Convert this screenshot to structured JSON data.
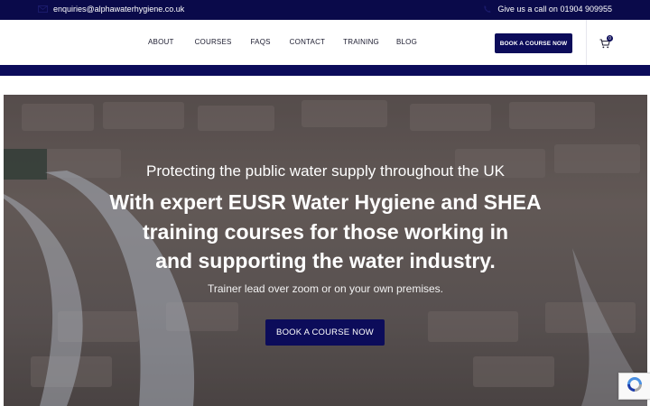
{
  "topbar": {
    "email": "enquiries@alphawaterhygiene.co.uk",
    "phone": "Give us a call on 01904 909955",
    "email_icon": "envelope-icon",
    "phone_icon": "phone-icon"
  },
  "nav": {
    "items": [
      {
        "label": "ABOUT"
      },
      {
        "label": "COURSES"
      },
      {
        "label": "FAQS"
      },
      {
        "label": "CONTACT"
      },
      {
        "label": "TRAINING"
      },
      {
        "label": "BLOG"
      }
    ],
    "cta_label": "BOOK A COURSE NOW",
    "cart_count": "0",
    "cart_icon": "cart-icon"
  },
  "hero": {
    "subtitle": "Protecting the public water supply throughout the UK",
    "headline_line1": "With expert EUSR Water Hygiene and SHEA",
    "headline_line2": "training courses for those working in",
    "headline_line3": "and supporting the water industry.",
    "note": "Trainer lead over zoom or on your own premises.",
    "cta_label": "BOOK A COURSE NOW"
  },
  "colors": {
    "brand_navy": "#0c0c5a",
    "topbar_bg": "#0a0a4a",
    "white": "#ffffff"
  },
  "recaptcha_icon": "recaptcha-icon"
}
